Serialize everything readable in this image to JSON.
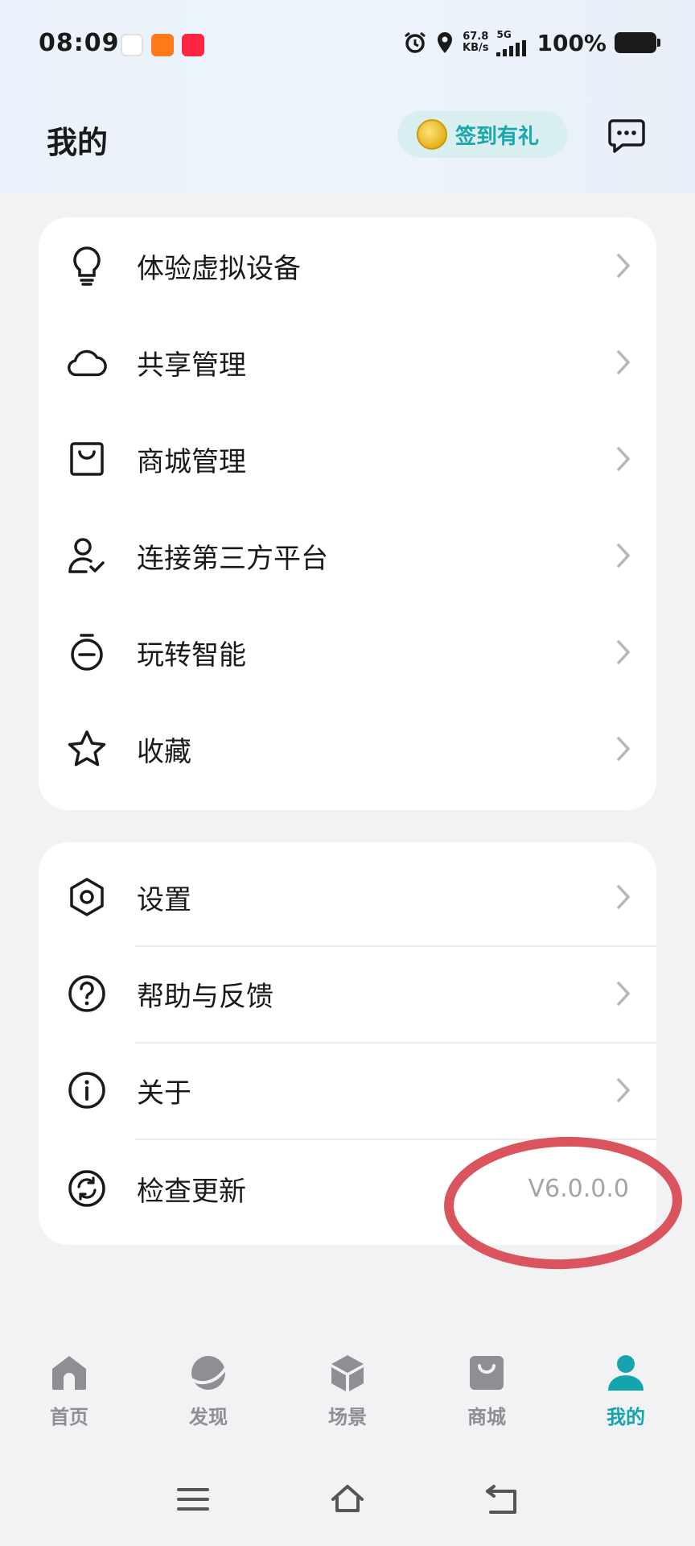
{
  "status_bar": {
    "time": "08:09",
    "net_speed_value": "67.8",
    "net_speed_unit": "KB/s",
    "network": "5G",
    "battery": "100%"
  },
  "header": {
    "title": "我的",
    "checkin_label": "签到有礼"
  },
  "menu_group_1": [
    {
      "label": "体验虚拟设备",
      "icon": "bulb-icon"
    },
    {
      "label": "共享管理",
      "icon": "cloud-icon"
    },
    {
      "label": "商城管理",
      "icon": "shop-bag-icon"
    },
    {
      "label": "连接第三方平台",
      "icon": "user-check-icon"
    },
    {
      "label": "玩转智能",
      "icon": "timer-icon"
    },
    {
      "label": "收藏",
      "icon": "star-icon"
    }
  ],
  "menu_group_2": [
    {
      "label": "设置",
      "icon": "settings-hex-icon"
    },
    {
      "label": "帮助与反馈",
      "icon": "help-icon"
    },
    {
      "label": "关于",
      "icon": "info-icon"
    },
    {
      "label": "检查更新",
      "icon": "refresh-icon",
      "value": "V6.0.0.0"
    }
  ],
  "bottom_nav": [
    {
      "label": "首页",
      "icon": "home-icon"
    },
    {
      "label": "发现",
      "icon": "discover-icon"
    },
    {
      "label": "场景",
      "icon": "cube-icon"
    },
    {
      "label": "商城",
      "icon": "bag-icon"
    },
    {
      "label": "我的",
      "icon": "person-icon",
      "active": true
    }
  ],
  "colors": {
    "accent": "#14a4ad",
    "annotation": "#d9545d",
    "inactive": "#8e8e93"
  }
}
